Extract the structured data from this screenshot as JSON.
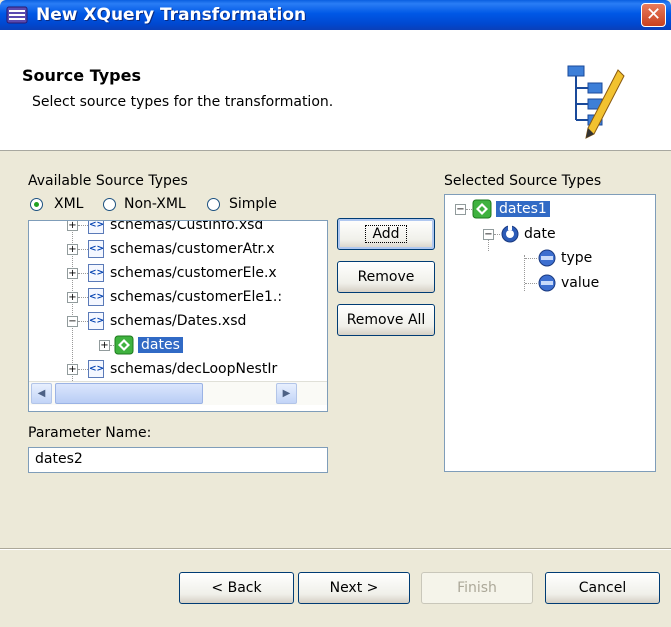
{
  "window": {
    "title": "New XQuery Transformation",
    "close_glyph": "✕"
  },
  "header": {
    "title": "Source Types",
    "description": "Select source types for the transformation."
  },
  "available": {
    "label": "Available Source Types",
    "radios": [
      {
        "label": "XML",
        "checked": true
      },
      {
        "label": "Non-XML",
        "checked": false
      },
      {
        "label": "Simple",
        "checked": false
      }
    ],
    "tree": [
      {
        "text": "schemas/CustInfo.xsd",
        "expander": "+",
        "icon": "xml-file-icon",
        "selected": false
      },
      {
        "text": "schemas/customerAtr.x",
        "expander": "+",
        "icon": "xml-file-icon",
        "selected": false
      },
      {
        "text": "schemas/customerEle.x",
        "expander": "+",
        "icon": "xml-file-icon",
        "selected": false
      },
      {
        "text": "schemas/customerEle1.:",
        "expander": "+",
        "icon": "xml-file-icon",
        "selected": false
      },
      {
        "text": "schemas/Dates.xsd",
        "expander": "−",
        "icon": "xml-file-icon",
        "selected": false
      },
      {
        "text": "dates",
        "expander": "+",
        "icon": "element-icon",
        "selected": true
      },
      {
        "text": "schemas/decLoopNestIr",
        "expander": "+",
        "icon": "xml-file-icon",
        "selected": false
      }
    ]
  },
  "parameter": {
    "label": "Parameter Name:",
    "value": "dates2"
  },
  "actions": {
    "add": "Add",
    "remove": "Remove",
    "remove_all": "Remove All"
  },
  "selected": {
    "label": "Selected Source Types",
    "tree": [
      {
        "text": "dates1",
        "expander": "−",
        "icon": "element-icon",
        "selected": true
      },
      {
        "text": "date",
        "expander": "−",
        "icon": "complex-type-icon",
        "selected": false
      },
      {
        "text": "type",
        "expander": "",
        "icon": "attribute-icon",
        "selected": false
      },
      {
        "text": "value",
        "expander": "",
        "icon": "attribute-icon",
        "selected": false
      }
    ]
  },
  "footer": {
    "back": "< Back",
    "next": "Next >",
    "finish": "Finish",
    "cancel": "Cancel"
  },
  "colors": {
    "titlebar": "#0058e6",
    "selection": "#316ac5",
    "dialog_bg": "#ece9d8",
    "element_icon": "#3fb23f"
  }
}
